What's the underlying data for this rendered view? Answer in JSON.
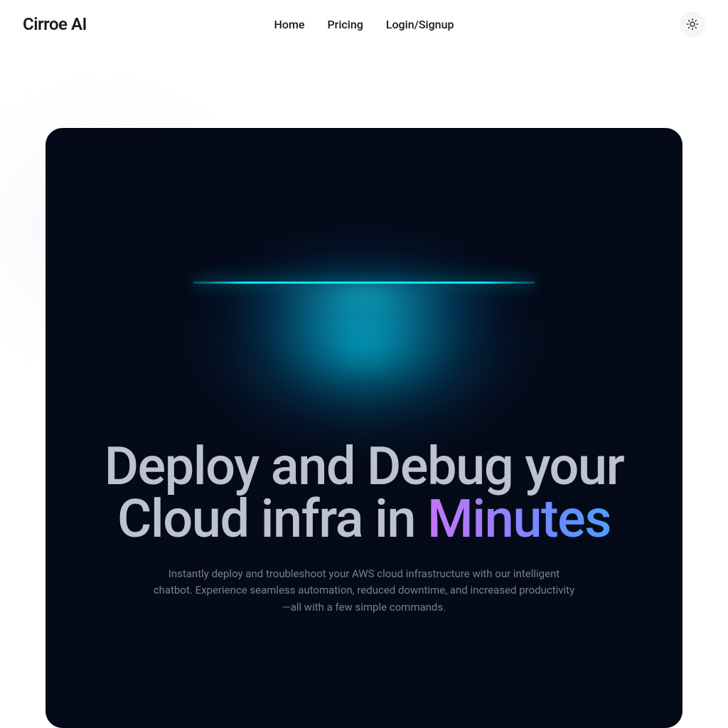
{
  "header": {
    "brand": "Cirroe AI",
    "nav": {
      "home": "Home",
      "pricing": "Pricing",
      "login": "Login/Signup"
    }
  },
  "hero": {
    "headline_line1": "Deploy and Debug your",
    "headline_line2_prefix": "Cloud infra in ",
    "headline_accent": "Minutes",
    "subtext": "Instantly deploy and troubleshoot your AWS cloud infrastructure with our intelligent chatbot. Experience seamless automation, reduced downtime, and increased productivity—all with a few simple commands."
  }
}
